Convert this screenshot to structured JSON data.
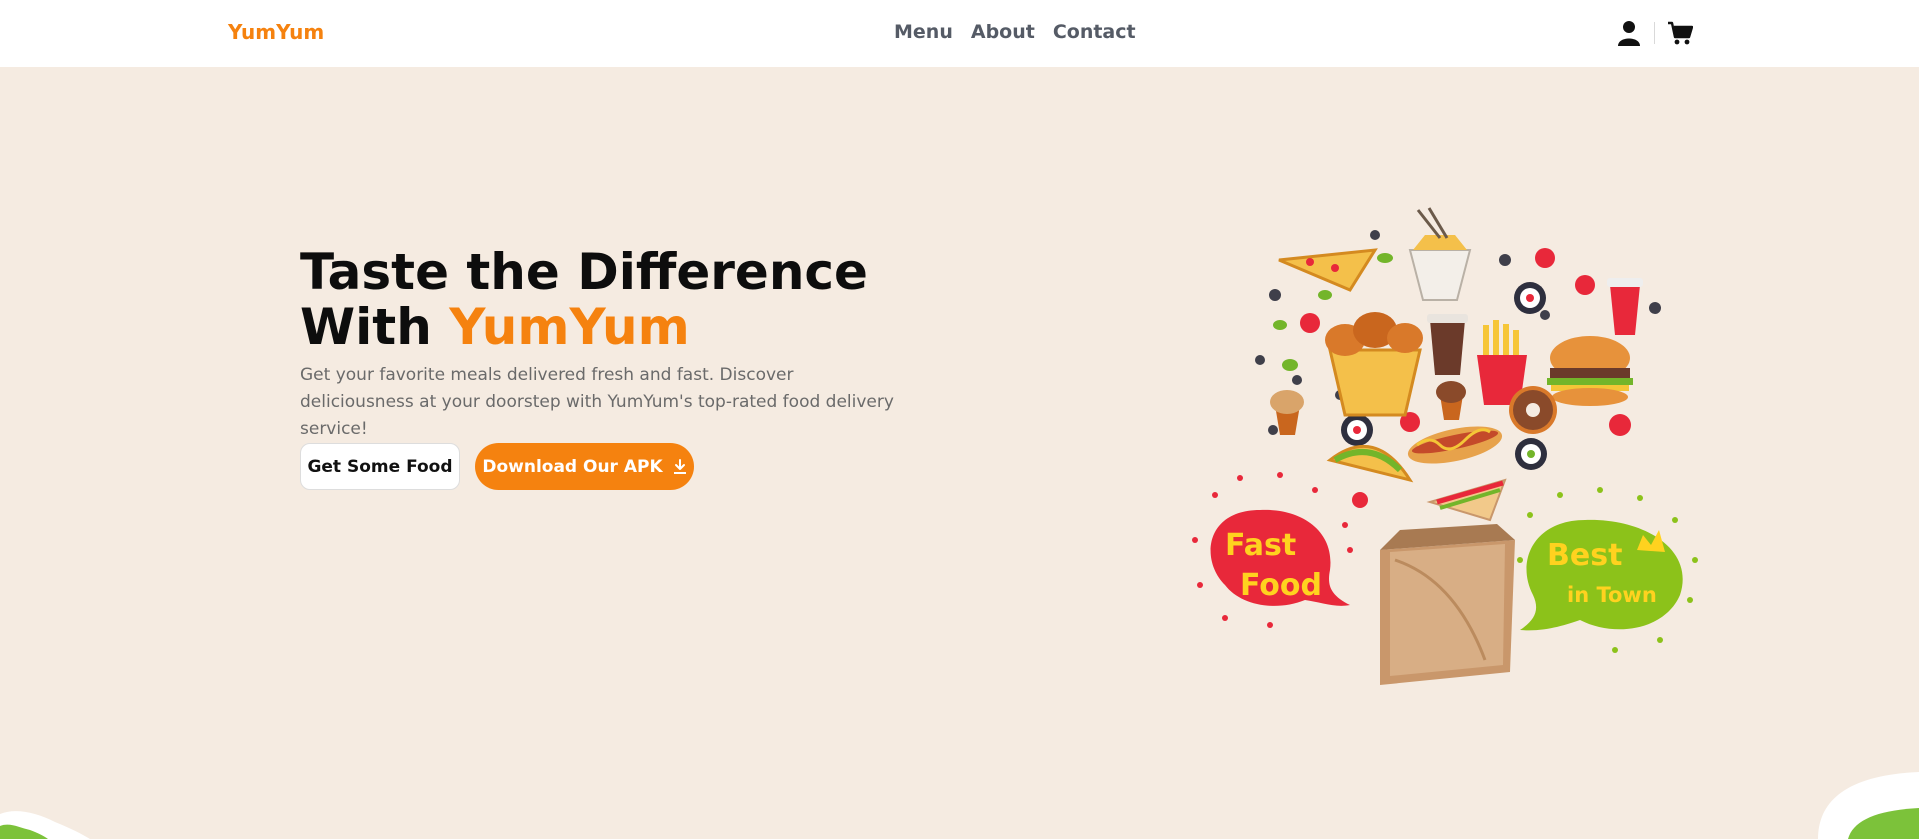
{
  "brand": {
    "name": "YumYum",
    "color": "#f5820f"
  },
  "nav": {
    "links": [
      {
        "label": "Menu"
      },
      {
        "label": "About"
      },
      {
        "label": "Contact"
      }
    ],
    "icons": [
      "user-icon",
      "cart-icon"
    ]
  },
  "hero": {
    "title_line1": "Taste the Difference",
    "title_line2_prefix": "With",
    "title_brand": "YumYum",
    "subtitle": "Get your favorite meals delivered fresh and fast. Discover deliciousness at your doorstep with YumYum's top-rated food delivery service!",
    "primary_button": "Get Some Food",
    "secondary_button": "Download Our APK",
    "secondary_button_icon": "download-icon"
  },
  "illustration": {
    "badge_left": [
      "Fast",
      "Food"
    ],
    "badge_right": [
      "Best",
      "in Town"
    ],
    "colors": {
      "badge_left": "#e8283a",
      "badge_right": "#8cc21a",
      "badge_text": "#ffd21f",
      "bag": "#c9976b"
    }
  },
  "colors": {
    "accent": "#f5820f",
    "background": "#f5ebe1",
    "navbar": "#ffffff"
  }
}
